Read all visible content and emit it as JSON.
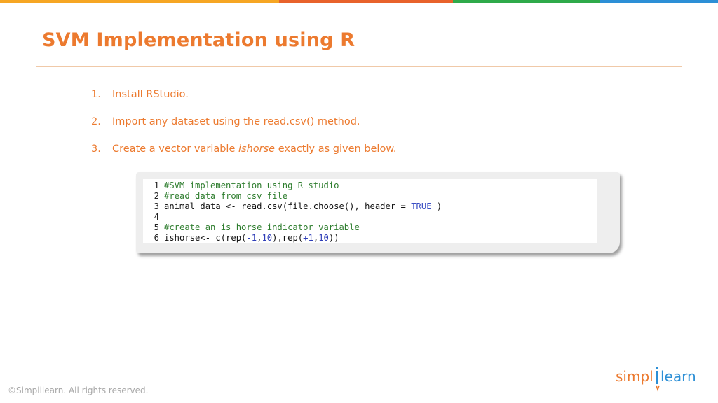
{
  "colors": {
    "accent": "#ec7a2f",
    "top_bar": [
      "#f6a623",
      "#e8622b",
      "#ec7a2f",
      "#2faa4a",
      "#2c8fd6"
    ],
    "code_comment": "#2e7d2e",
    "code_keyword": "#3b4fc4",
    "logo_text": "#2c8fd6"
  },
  "slide": {
    "title": "SVM Implementation using R",
    "steps": [
      {
        "num": "1.",
        "text": "Install RStudio."
      },
      {
        "num": "2.",
        "text": "Import any dataset using the read.csv() method."
      },
      {
        "num": "3.",
        "text_before": "Create a vector variable ",
        "text_em": "ishorse",
        "text_after": " exactly as given below."
      }
    ]
  },
  "code": {
    "line_numbers": [
      "1",
      "2",
      "3",
      "4",
      "5",
      "6"
    ],
    "line1": "#SVM implementation using R studio",
    "line2": "#read data from csv file",
    "line3_a": "animal_data <- read.csv(file.choose(), header = ",
    "line3_kw": "TRUE",
    "line3_b": " )",
    "line5": "#create an is horse indicator variable",
    "line6_a": "ishorse<- c(rep(",
    "line6_n1": "-1",
    "line6_b": ",",
    "line6_n2": "10",
    "line6_c": "),rep(",
    "line6_n3": "+1",
    "line6_d": ",",
    "line6_n4": "10",
    "line6_e": "))"
  },
  "footer": {
    "copyright": "©Simplilearn. All rights reserved.",
    "logo_text": "simplilearn"
  }
}
